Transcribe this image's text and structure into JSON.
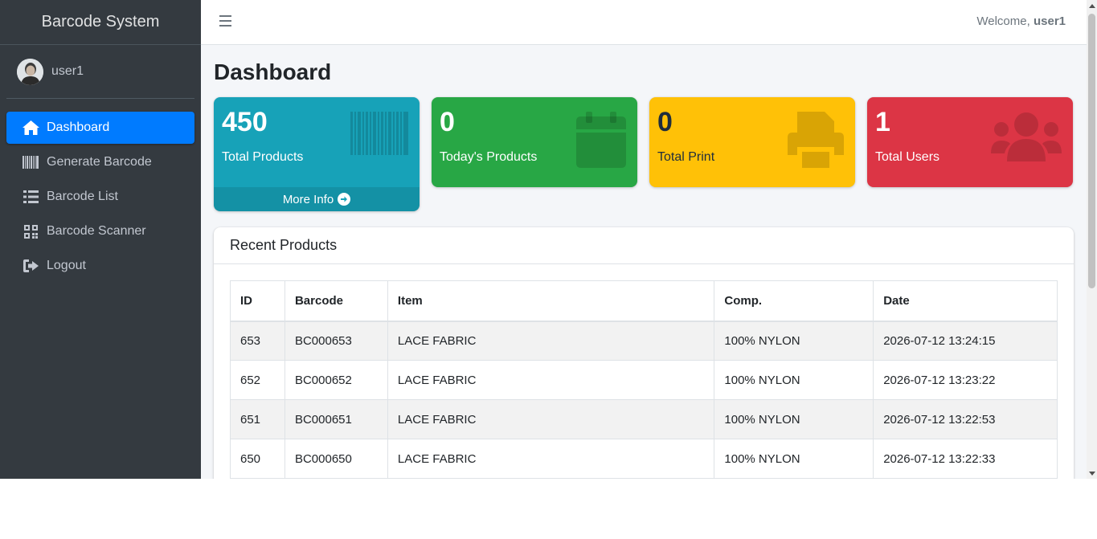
{
  "app": {
    "brand": "Barcode System",
    "user": "user1"
  },
  "sidebar": {
    "items": [
      {
        "label": "Dashboard",
        "icon": "home-icon",
        "active": true
      },
      {
        "label": "Generate Barcode",
        "icon": "barcode-icon"
      },
      {
        "label": "Barcode List",
        "icon": "list-icon"
      },
      {
        "label": "Barcode Scanner",
        "icon": "qrcode-icon"
      },
      {
        "label": "Logout",
        "icon": "sign-out-icon"
      }
    ]
  },
  "topbar": {
    "welcome_prefix": "Welcome,",
    "welcome_user": "user1"
  },
  "page": {
    "title": "Dashboard"
  },
  "stats": [
    {
      "value": "450",
      "label": "Total Products",
      "color": "#17a2b8",
      "icon": "barcode-icon",
      "more": "More Info"
    },
    {
      "value": "0",
      "label": "Today's Products",
      "color": "#28a745",
      "icon": "calendar-icon"
    },
    {
      "value": "0",
      "label": "Total Print",
      "color": "#ffc107",
      "icon": "print-icon"
    },
    {
      "value": "1",
      "label": "Total Users",
      "color": "#dc3545",
      "icon": "users-icon"
    }
  ],
  "recent": {
    "title": "Recent Products",
    "columns": [
      "ID",
      "Barcode",
      "Item",
      "Comp.",
      "Date"
    ],
    "rows": [
      [
        "653",
        "BC000653",
        "LACE FABRIC",
        "100% NYLON",
        "2026-07-12 13:24:15"
      ],
      [
        "652",
        "BC000652",
        "LACE FABRIC",
        "100% NYLON",
        "2026-07-12 13:23:22"
      ],
      [
        "651",
        "BC000651",
        "LACE FABRIC",
        "100% NYLON",
        "2026-07-12 13:22:53"
      ],
      [
        "650",
        "BC000650",
        "LACE FABRIC",
        "100% NYLON",
        "2026-07-12 13:22:33"
      ]
    ]
  }
}
